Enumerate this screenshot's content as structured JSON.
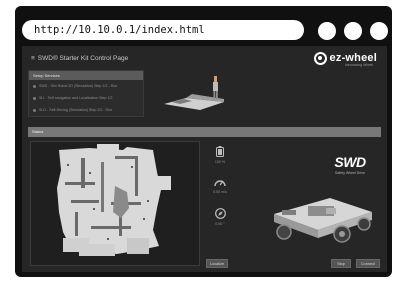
{
  "browser": {
    "url": "http://10.10.0.1/index.html"
  },
  "app": {
    "title": "SWD® Starter Kit Control Page",
    "menu_icon": "hamburger-icon"
  },
  "brand": {
    "name": "ez-wheel",
    "tagline": "Introducing Wheel"
  },
  "systems": {
    "header": "Setup Services",
    "items": [
      "SWD - Sim Robot 2D (Simulation) Step 1/2 - Run",
      "SLI - Self navigation and Localization Step 1/2",
      "SLD - Self-Driving (Simulation) Step 2/2 - Run"
    ]
  },
  "status": {
    "label": "Status"
  },
  "metrics": [
    {
      "icon": "battery-icon",
      "value": "100 %"
    },
    {
      "icon": "speedometer-icon",
      "value": "0.00 m/s"
    },
    {
      "icon": "compass-icon",
      "value": "0.00 °"
    }
  ],
  "product": {
    "logo_text": "SWD",
    "logo_sub": "Safety Wheel Drive"
  },
  "buttons": {
    "map": "Localize",
    "stop": "Stop",
    "connect": "Connect"
  },
  "colors": {
    "page_bg": "#262626",
    "frame": "#101010",
    "status_bar": "#787878",
    "button": "#555555"
  }
}
